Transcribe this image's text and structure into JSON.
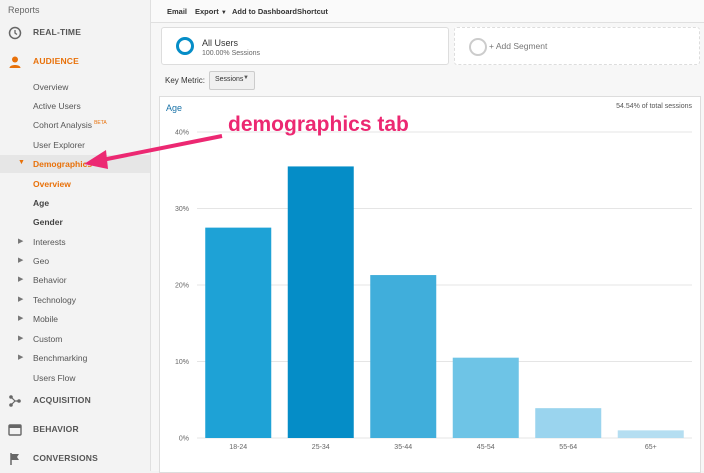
{
  "sidebar": {
    "reports_label": "Reports",
    "sections": [
      {
        "label": "REAL-TIME",
        "icon": "clock-icon"
      },
      {
        "label": "AUDIENCE",
        "icon": "person-icon"
      },
      {
        "label": "ACQUISITION",
        "icon": "acquisition-icon"
      },
      {
        "label": "BEHAVIOR",
        "icon": "behavior-icon"
      },
      {
        "label": "CONVERSIONS",
        "icon": "flag-icon"
      }
    ],
    "audience_items": [
      {
        "label": "Overview"
      },
      {
        "label": "Active Users"
      },
      {
        "label": "Cohort Analysis",
        "badge": "BETA"
      },
      {
        "label": "User Explorer"
      },
      {
        "label": "Demographics"
      },
      {
        "label": "Overview"
      },
      {
        "label": "Age"
      },
      {
        "label": "Gender"
      },
      {
        "label": "Interests"
      },
      {
        "label": "Geo"
      },
      {
        "label": "Behavior"
      },
      {
        "label": "Technology"
      },
      {
        "label": "Mobile"
      },
      {
        "label": "Custom"
      },
      {
        "label": "Benchmarking"
      },
      {
        "label": "Users Flow"
      }
    ]
  },
  "toolbar": {
    "email": "Email",
    "export": "Export",
    "add_dashboard": "Add to Dashboard",
    "shortcut": "Shortcut"
  },
  "segments": {
    "all_users_title": "All Users",
    "all_users_sub": "100.00% Sessions",
    "add_segment": "+ Add Segment"
  },
  "key_metric": {
    "label": "Key Metric:",
    "value": "Sessions"
  },
  "chart_panel": {
    "title": "Age",
    "total_pct": "54.54% of total sessions"
  },
  "annotation": {
    "text": "demographics tab",
    "color": "#ec2872"
  },
  "colors": {
    "accent_orange": "#e8710a",
    "ga_blue": "#058dc7"
  },
  "chart_data": {
    "type": "bar",
    "categories": [
      "18-24",
      "25-34",
      "35-44",
      "45-54",
      "55-64",
      "65+"
    ],
    "values": [
      27.5,
      35.5,
      21.3,
      10.5,
      3.9,
      1.0
    ],
    "colors": [
      "#1ea2d6",
      "#058dc7",
      "#40aedb",
      "#6ec4e6",
      "#9ad4ee",
      "#b5def1"
    ],
    "yticks": [
      "0%",
      "10%",
      "20%",
      "30%",
      "40%"
    ],
    "ylim": [
      0,
      40
    ],
    "grid": true,
    "legend": "none"
  }
}
